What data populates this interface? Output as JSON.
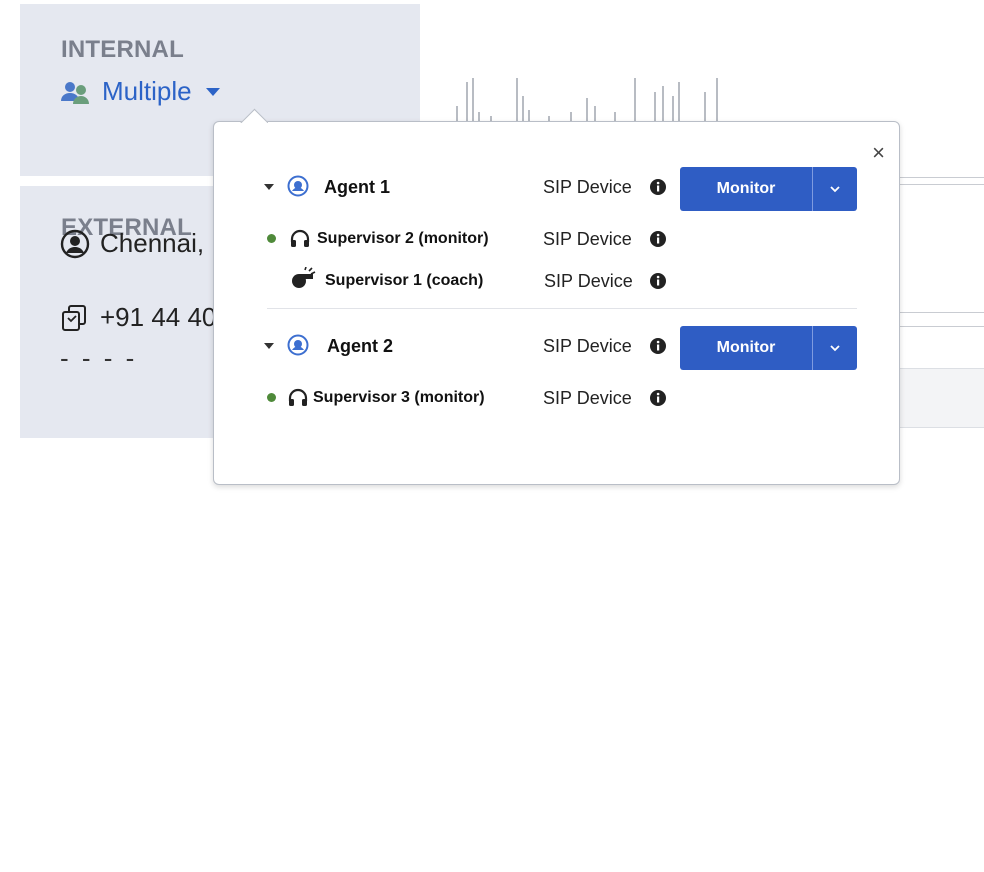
{
  "internal": {
    "label": "INTERNAL",
    "multiple_label": "Multiple"
  },
  "external": {
    "label": "EXTERNAL",
    "location": "Chennai,",
    "phone": "+91 44 40",
    "placeholder": "- -  - -"
  },
  "popover": {
    "close_label": "×",
    "groups": [
      {
        "agent": "Agent 1",
        "device": "SIP Device",
        "monitor_label": "Monitor",
        "supervisors": [
          {
            "name": "Supervisor 2 (monitor)",
            "device": "SIP Device",
            "mode": "monitor"
          },
          {
            "name": "Supervisor 1 (coach)",
            "device": "SIP Device",
            "mode": "coach"
          }
        ]
      },
      {
        "agent": "Agent 2",
        "device": "SIP Device",
        "monitor_label": "Monitor",
        "supervisors": [
          {
            "name": "Supervisor 3 (monitor)",
            "device": "SIP Device",
            "mode": "monitor"
          }
        ]
      }
    ]
  },
  "colors": {
    "accent": "#2f5dc4",
    "link": "#2c63c7",
    "panel_bg": "#e5e8f0",
    "label_gray": "#7a7f8c",
    "status_green": "#4f8a3a"
  },
  "icons": {
    "multiple": "users-icon",
    "agent": "agent-headset-icon",
    "monitor": "headphones-icon",
    "coach": "whistle-icon",
    "info": "info-icon",
    "location": "user-circle-icon",
    "phone": "copy-phone-icon",
    "close": "close-icon"
  }
}
